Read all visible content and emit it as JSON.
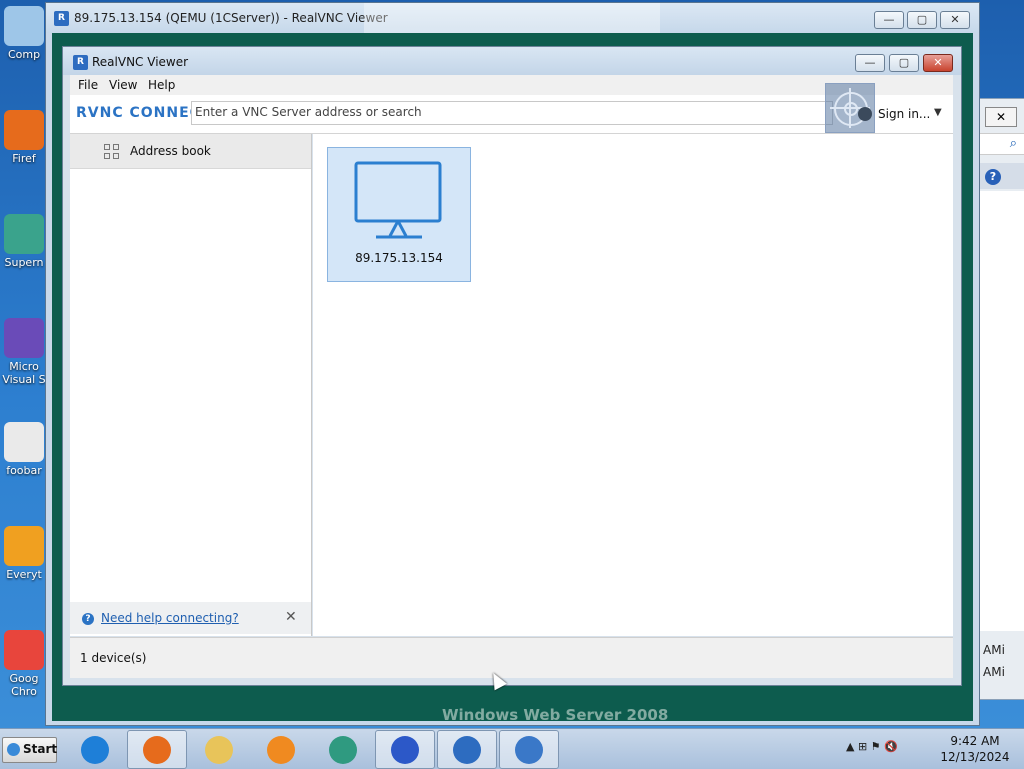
{
  "desktop": {
    "icons": [
      {
        "label": "Comp",
        "icon": "computer-icon",
        "color": "#9ec6e8"
      },
      {
        "label": "Firef",
        "icon": "firefox-icon",
        "color": "#e66b1c"
      },
      {
        "label": "Supern",
        "icon": "supernova-icon",
        "color": "#3aa38c"
      },
      {
        "label": "Micro Visual S",
        "icon": "visual-studio-icon",
        "color": "#6a4bb8"
      },
      {
        "label": "foobar",
        "icon": "foobar-icon",
        "color": "#eaeaea"
      },
      {
        "label": "Everyt",
        "icon": "everything-icon",
        "color": "#f0a020"
      },
      {
        "label": "Goog Chro",
        "icon": "chrome-icon",
        "color": "#e8453c"
      }
    ]
  },
  "right_window": {
    "close_glyph": "✕",
    "search_glyph": "⌕",
    "help_glyph": "?",
    "line1": "AMi",
    "line2": "AMi"
  },
  "outer_window": {
    "title": "89.175.13.154 (QEMU (1CServer)) - RealVNC Viewer",
    "app_icon_glyph": "R",
    "minimize": "—",
    "maximize": "▢",
    "close": "✕",
    "remote_background_text": "Windows Web Server 2008"
  },
  "viewer": {
    "title": "RealVNC Viewer",
    "app_icon_glyph": "R",
    "minimize": "—",
    "maximize": "▢",
    "close": "✕",
    "menu": {
      "file": "File",
      "view": "View",
      "help": "Help"
    },
    "toolbar": {
      "logo": "RVNC CONNECT",
      "search_placeholder": "Enter a VNC Server address or search",
      "sign_in": "Sign in...",
      "caret": "▼"
    },
    "sidebar": {
      "address_book": "Address book",
      "help_link": "Need help connecting?",
      "help_icon": "?",
      "close_glyph": "✕"
    },
    "devices": [
      {
        "label": "89.175.13.154",
        "icon": "monitor-icon"
      }
    ],
    "status": "1 device(s)"
  },
  "taskbar": {
    "start_label": "Start",
    "apps": [
      {
        "icon": "internet-explorer-icon",
        "color": "#1e7fd8",
        "active": false
      },
      {
        "icon": "firefox-icon",
        "color": "#e66b1c",
        "active": true
      },
      {
        "icon": "file-explorer-icon",
        "color": "#e8c45a",
        "active": false
      },
      {
        "icon": "media-player-icon",
        "color": "#f08a20",
        "active": false
      },
      {
        "icon": "supernova-icon",
        "color": "#2f9a80",
        "active": false
      },
      {
        "icon": "sailing-app-icon",
        "color": "#2c58c8",
        "active": true
      },
      {
        "icon": "realvnc-icon",
        "color": "#2d6cc0",
        "active": true
      },
      {
        "icon": "remote-desktop-icon",
        "color": "#3a78c8",
        "active": true
      }
    ],
    "tray_glyphs": "▲  ⊞  ⚑  🔇",
    "time": "9:42 AM",
    "date": "12/13/2024"
  }
}
